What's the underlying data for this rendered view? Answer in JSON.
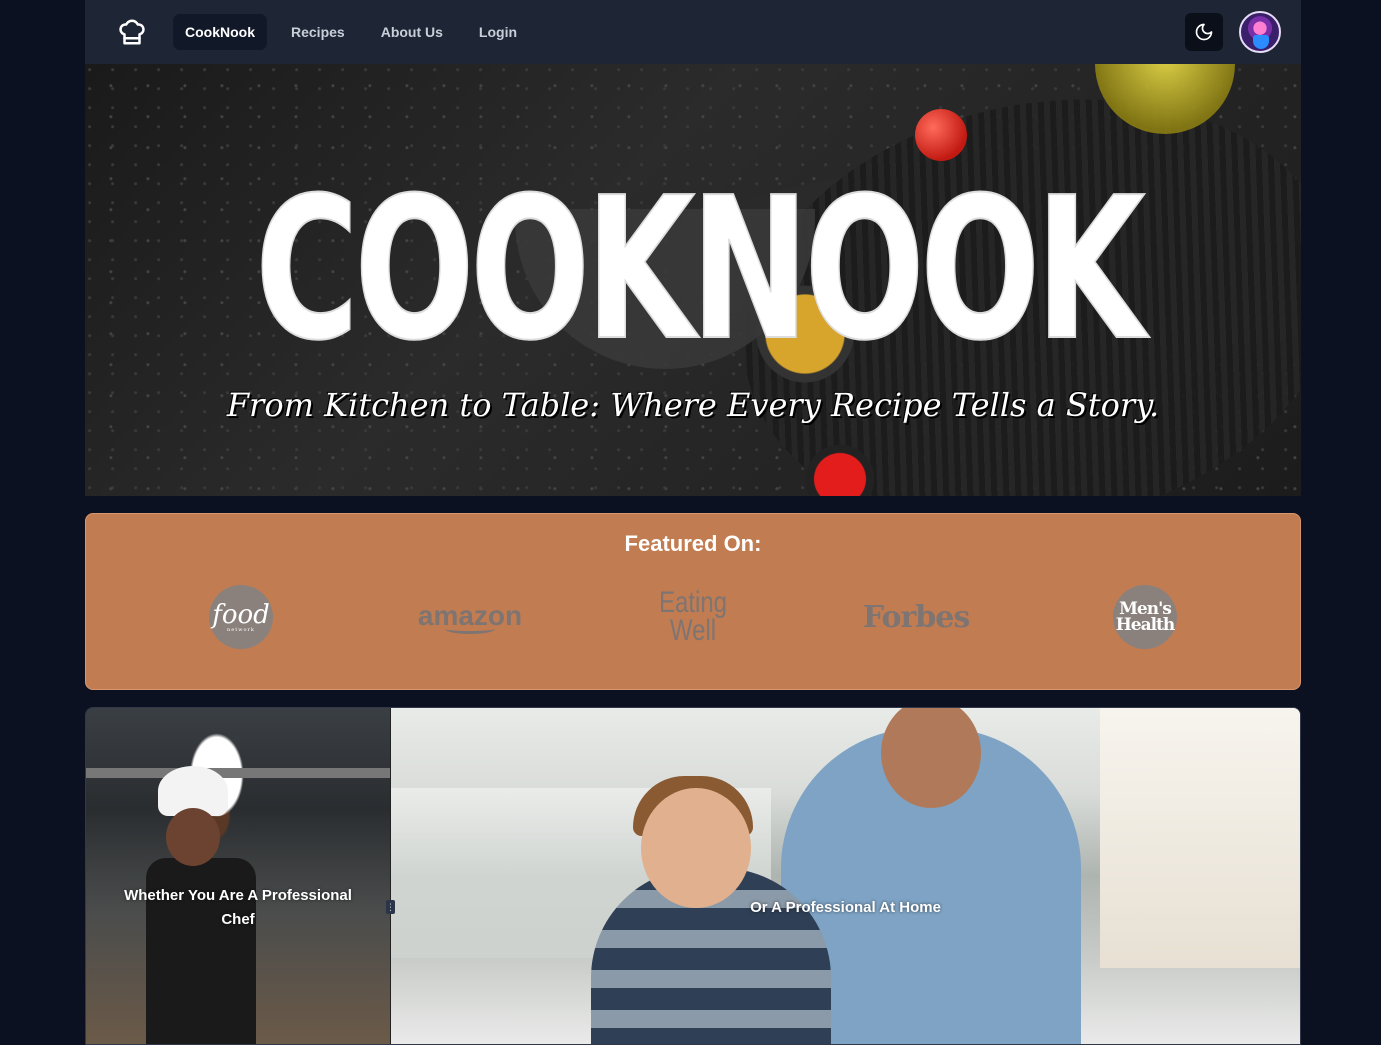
{
  "nav": {
    "brand": "CookNook",
    "items": [
      {
        "label": "Recipes"
      },
      {
        "label": "About Us"
      },
      {
        "label": "Login"
      }
    ],
    "logo_icon": "chef-hat-icon",
    "theme_icon": "moon-icon"
  },
  "hero": {
    "title": "COOKNOOK",
    "tagline": "From Kitchen to Table: Where Every Recipe Tells a Story."
  },
  "featured": {
    "heading": "Featured On:",
    "logos": [
      {
        "name": "food",
        "sub": "network"
      },
      {
        "name": "amazon"
      },
      {
        "name": "Eating",
        "line2": "Well"
      },
      {
        "name": "Forbes"
      },
      {
        "name": "Men's",
        "line2": "Health"
      }
    ],
    "background": "#c27c52"
  },
  "split": {
    "left_text": "Whether You Are A Professional Chef",
    "right_text": "Or A Professional At Home",
    "handle_icon": "drag-handle-icon"
  },
  "colors": {
    "page_bg": "#0b1120",
    "nav_bg": "#1e2535",
    "accent": "#c27c52"
  }
}
